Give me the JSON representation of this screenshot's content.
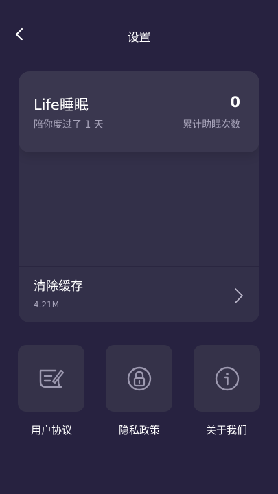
{
  "header": {
    "title": "设置",
    "back_icon": "chevron-left-icon"
  },
  "stats": {
    "app_name": "Life睡眠",
    "days_text": "陪你度过了 1 天",
    "count": "0",
    "count_label": "累计助眠次数"
  },
  "cache": {
    "label": "清除缓存",
    "size": "4.21M",
    "chevron_icon": "chevron-right-icon"
  },
  "tiles": [
    {
      "label": "用户协议",
      "icon": "document-edit-icon"
    },
    {
      "label": "隐私政策",
      "icon": "lock-icon"
    },
    {
      "label": "关于我们",
      "icon": "info-icon"
    }
  ],
  "colors": {
    "background": "#272240",
    "card": "#333049",
    "card_top": "#3a374f",
    "tile": "#353249",
    "secondary_text": "#a8a4ba",
    "icon": "#9d99b0"
  }
}
